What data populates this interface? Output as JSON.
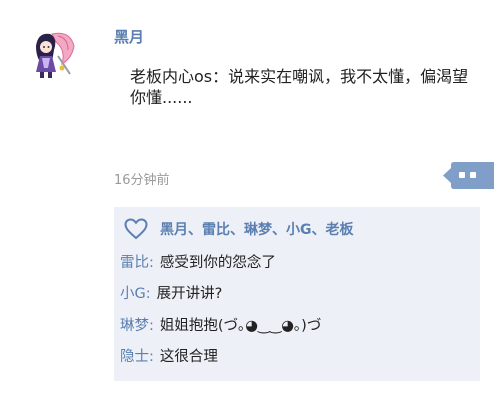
{
  "post": {
    "author": "黑月",
    "text": "老板内心os：说来实在嘲讽，我不太懂，偏渴望你懂......",
    "timestamp": "16分钟前"
  },
  "likes": {
    "names": "黑月、雷比、琳梦、小G、老板"
  },
  "comments": [
    {
      "name": "雷比",
      "sep": ":",
      "text": "感受到你的怨念了"
    },
    {
      "name": "小G",
      "sep": ":",
      "text": "展开讲讲?"
    },
    {
      "name": "琳梦",
      "sep": ":",
      "text": "姐姐抱抱(づ｡◕‿‿◕｡)づ"
    },
    {
      "name": "隐士",
      "sep": ":",
      "text": "这很合理"
    }
  ],
  "colors": {
    "name_blue": "#5a7fb0",
    "panel_bg": "#eef0f7",
    "more_button_bg": "#7f9fc8"
  },
  "icons": {
    "avatar": "anime-character-avatar",
    "more": "two-dots-icon",
    "like": "heart-outline-icon"
  }
}
